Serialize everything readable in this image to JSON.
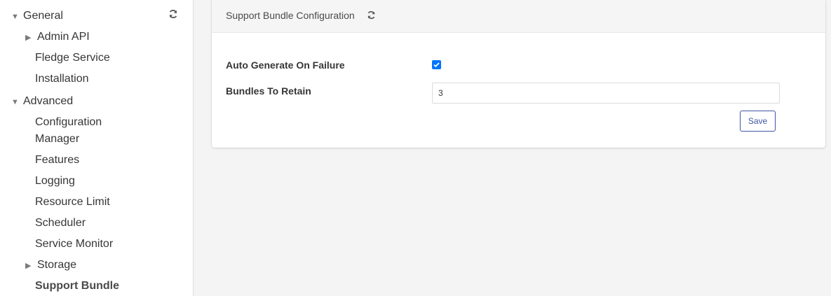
{
  "sidebar": {
    "items": [
      {
        "label": "General",
        "caret": "▼"
      },
      {
        "label": "Admin API",
        "caret": "▶"
      },
      {
        "label": "Fledge Service"
      },
      {
        "label": "Installation"
      },
      {
        "label": "Advanced",
        "caret": "▼"
      },
      {
        "label": "Configuration"
      },
      {
        "label": "Manager"
      },
      {
        "label": "Features"
      },
      {
        "label": "Logging"
      },
      {
        "label": "Resource Limit"
      },
      {
        "label": "Scheduler"
      },
      {
        "label": "Service Monitor"
      },
      {
        "label": "Storage",
        "caret": "▶"
      },
      {
        "label": "Support Bundle"
      }
    ],
    "refresh_icon": "refresh-icon"
  },
  "card": {
    "title": "Support Bundle Configuration",
    "refresh_icon": "refresh-icon"
  },
  "form": {
    "auto_generate_label": "Auto Generate On Failure",
    "auto_generate_checked": true,
    "bundles_label": "Bundles To Retain",
    "bundles_value": "3",
    "save_label": "Save"
  },
  "colors": {
    "accent": "#3e56a3",
    "checkbox": "#0075ff"
  }
}
